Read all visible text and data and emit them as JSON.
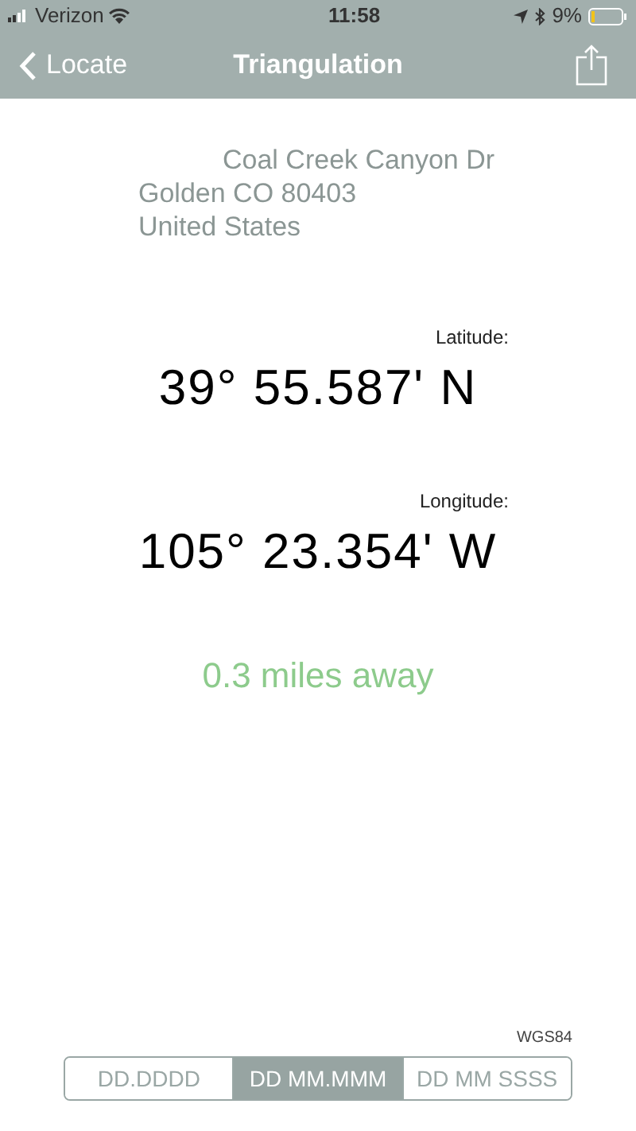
{
  "status_bar": {
    "carrier": "Verizon",
    "time": "11:58",
    "battery": "9%"
  },
  "nav": {
    "back": "Locate",
    "title": "Triangulation"
  },
  "address": [
    "Coal Creek Canyon Dr",
    "Golden CO 80403",
    "United States"
  ],
  "coordinates": [
    {
      "label": "Latitude:",
      "value": "39° 55.587' N"
    },
    {
      "label": "Longitude:",
      "value": "105° 23.354' W"
    }
  ],
  "distance": "0.3 miles away",
  "datum": "WGS84",
  "formats": [
    {
      "label": "DD.DDDD",
      "selected": false
    },
    {
      "label": "DD MM.MMM",
      "selected": true
    },
    {
      "label": "DD MM SSSS",
      "selected": false
    }
  ]
}
